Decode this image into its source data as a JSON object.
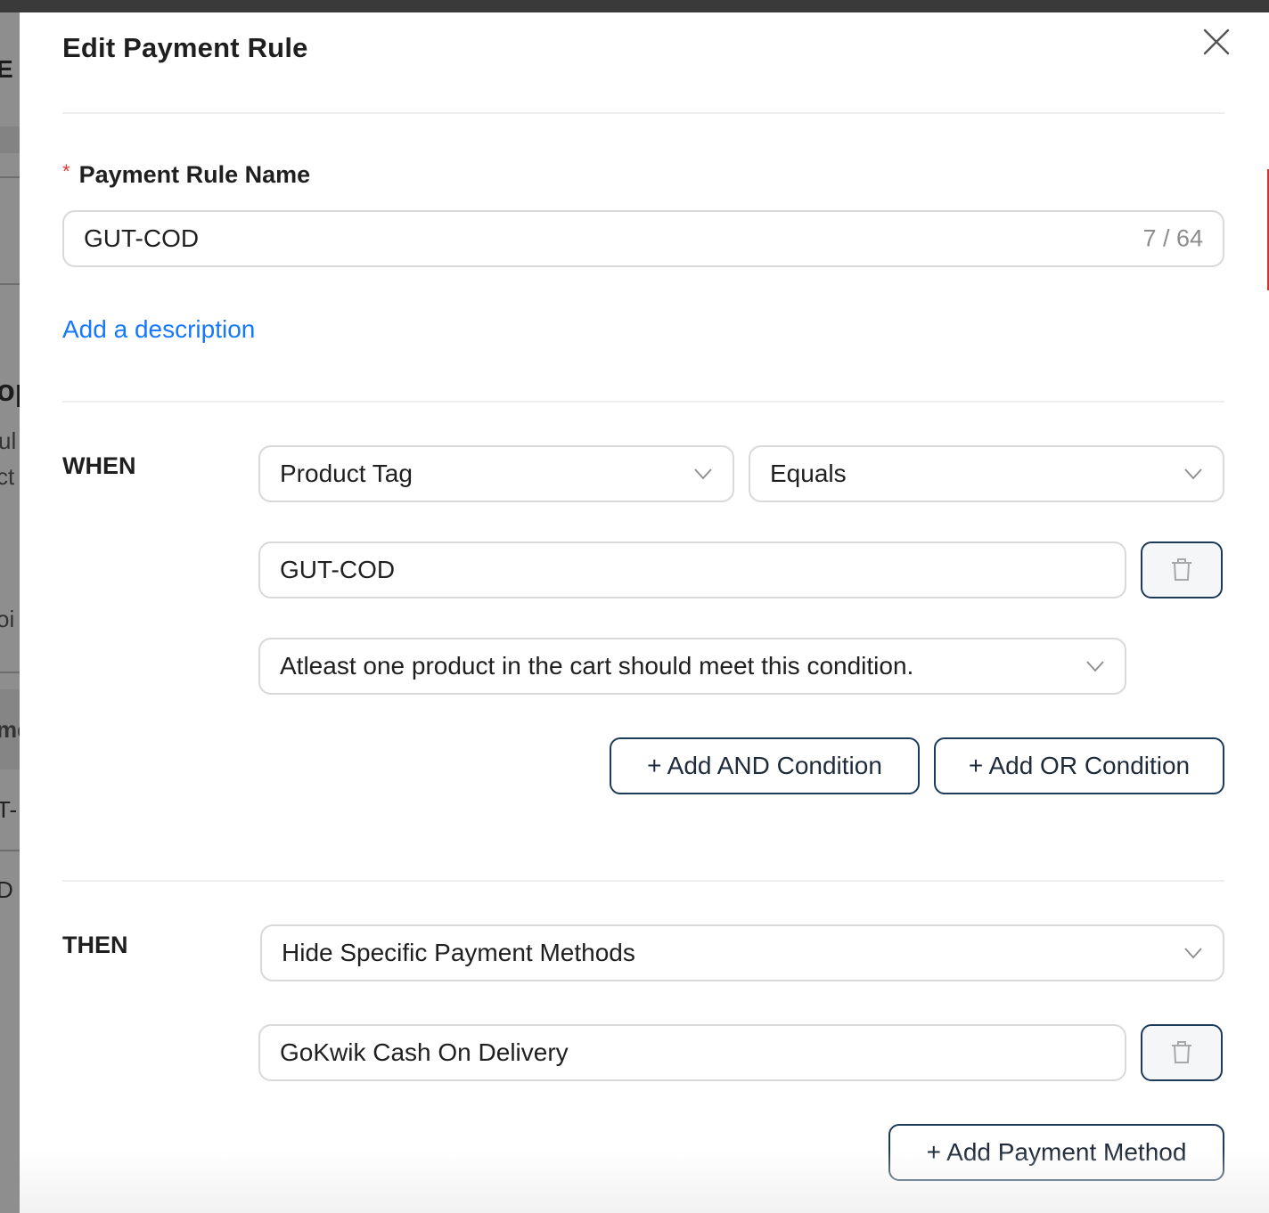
{
  "background": {
    "fragments": [
      "E S",
      "op",
      "ul",
      "ct",
      "oi",
      "me",
      "T-",
      "D"
    ]
  },
  "modal": {
    "title": "Edit Payment Rule",
    "close_icon": "close-icon"
  },
  "rule_name": {
    "label": "Payment Rule Name",
    "required_mark": "*",
    "value": "GUT-COD",
    "counter": "7 / 64"
  },
  "description_link": "Add a description",
  "when": {
    "label": "WHEN",
    "field_select": "Product Tag",
    "operator_select": "Equals",
    "value_input": "GUT-COD",
    "scope_select": "Atleast one product in the cart should meet this condition.",
    "add_and_label": "+ Add AND Condition",
    "add_or_label": "+ Add OR Condition"
  },
  "then": {
    "label": "THEN",
    "action_select": "Hide Specific Payment Methods",
    "payment_method_input": "GoKwik Cash On Delivery",
    "add_payment_label": "+ Add Payment Method"
  },
  "colors": {
    "accent_link": "#1677ff",
    "button_border": "#1c3a5a",
    "required": "#e53935"
  }
}
